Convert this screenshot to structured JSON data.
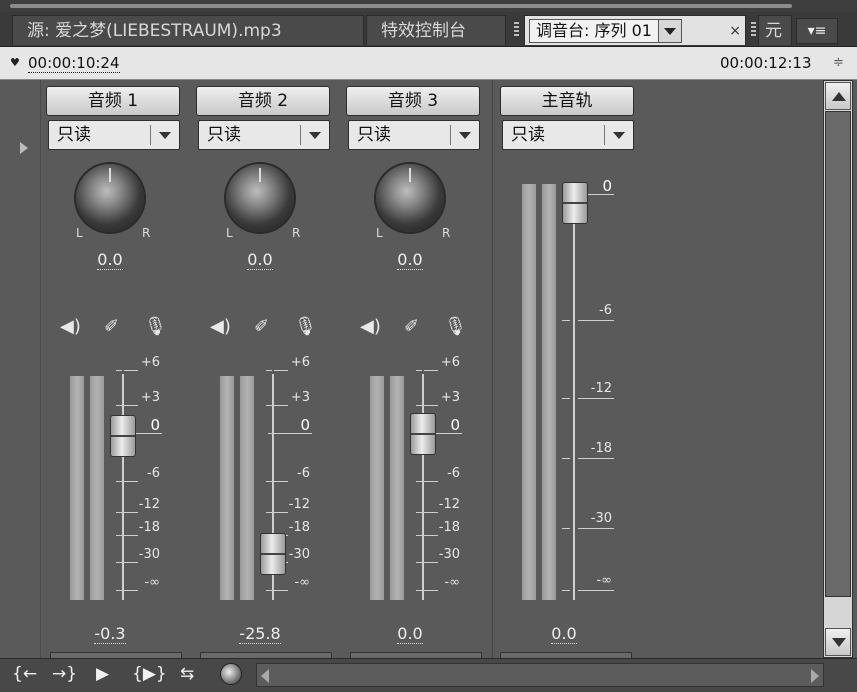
{
  "tabs": [
    {
      "label": "源: 爱之梦(LIEBESTRAUM).mp3"
    },
    {
      "label": "特效控制台"
    },
    {
      "label": "调音台: 序列 01"
    },
    {
      "label": "元"
    }
  ],
  "timebar": {
    "current_time": "00:00:10:24",
    "duration": "00:00:12:13"
  },
  "tracks": [
    {
      "name": "音频 1",
      "mode": "只读",
      "pan": "0.0",
      "volume": "-0.3",
      "knob_L": "L",
      "knob_R": "R"
    },
    {
      "name": "音频 2",
      "mode": "只读",
      "pan": "0.0",
      "volume": "-25.8",
      "knob_L": "L",
      "knob_R": "R"
    },
    {
      "name": "音频 3",
      "mode": "只读",
      "pan": "0.0",
      "volume": "0.0",
      "knob_L": "L",
      "knob_R": "R"
    }
  ],
  "master": {
    "name": "主音轨",
    "mode": "只读",
    "volume": "0.0"
  },
  "track_scale": [
    "+6",
    "+3",
    "0",
    "-6",
    "-12",
    "-18",
    "-30",
    "-∞"
  ],
  "master_scale": [
    "0",
    "-6",
    "-12",
    "-18",
    "-30",
    "-∞"
  ],
  "icons": {
    "mute": "speaker-icon",
    "solo": "headphone-icon",
    "record": "microphone-icon",
    "toolbar": [
      "go-to-in-point-icon",
      "go-to-out-point-icon",
      "play-icon",
      "play-in-to-out-icon",
      "loop-icon",
      "record-icon"
    ]
  },
  "colors": {
    "panel_bg": "#5a5a5a",
    "tab_active": "#e2e2e2",
    "timebar_bg": "#e6e6e6"
  }
}
